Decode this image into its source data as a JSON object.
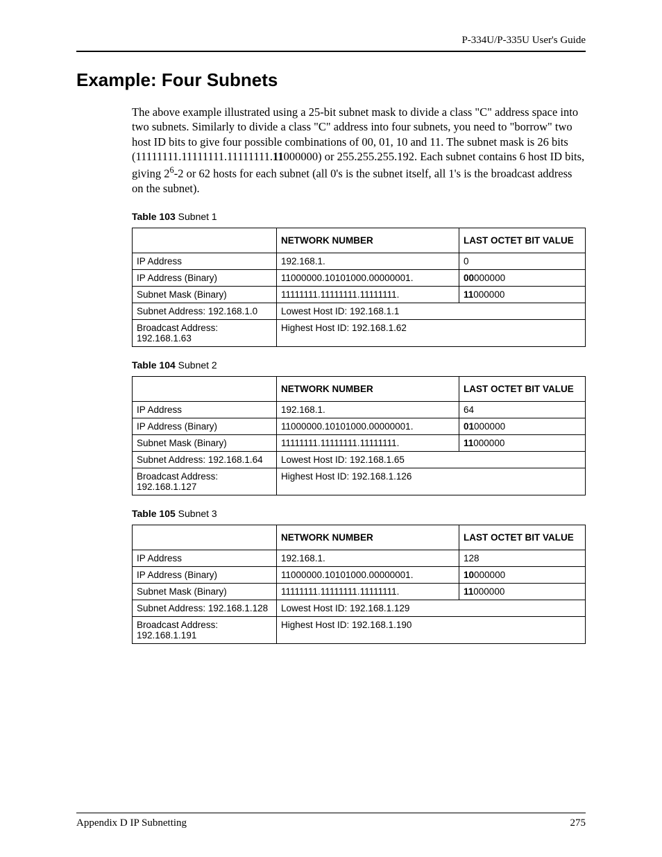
{
  "header": {
    "guide_title": "P-334U/P-335U User's Guide"
  },
  "section": {
    "title": "Example: Four Subnets"
  },
  "body": {
    "p1_a": "The above example illustrated using a 25-bit subnet mask to divide a class \"C\" address space into two subnets. Similarly to divide a class \"C\" address into four subnets, you need to \"borrow\" two host ID bits to give four possible combinations of 00, 01, 10 and 11. The subnet mask is 26 bits (11111111.11111111.11111111.",
    "p1_bold": "11",
    "p1_b": "000000) or 255.255.255.192. Each subnet contains 6 host ID bits, giving 2",
    "p1_sup": "6",
    "p1_c": "-2 or 62 hosts for each subnet (all 0's is the subnet itself, all 1's is the broadcast address on the subnet)."
  },
  "tables": [
    {
      "caption_bold": "Table 103",
      "caption_rest": "   Subnet 1",
      "headers": [
        "",
        "NETWORK NUMBER",
        "LAST OCTET BIT VALUE"
      ],
      "rows": [
        {
          "cells": [
            "IP Address",
            "192.168.1.",
            "0"
          ]
        },
        {
          "cells": [
            "IP Address (Binary)",
            "11000000.10101000.00000001.",
            {
              "bold": "00",
              "rest": "000000"
            }
          ]
        },
        {
          "cells": [
            "Subnet Mask (Binary)",
            "11111111.11111111.11111111.",
            {
              "bold": "11",
              "rest": "000000"
            }
          ]
        },
        {
          "cells": [
            "Subnet Address: 192.168.1.0",
            "Lowest Host ID: 192.168.1.1"
          ],
          "span": true
        },
        {
          "cells": [
            "Broadcast Address: 192.168.1.63",
            "Highest Host ID: 192.168.1.62"
          ],
          "span": true
        }
      ]
    },
    {
      "caption_bold": "Table 104",
      "caption_rest": "   Subnet 2",
      "headers": [
        "",
        "NETWORK NUMBER",
        "LAST OCTET BIT VALUE"
      ],
      "rows": [
        {
          "cells": [
            "IP Address",
            "192.168.1.",
            "64"
          ]
        },
        {
          "cells": [
            "IP Address (Binary)",
            "11000000.10101000.00000001.",
            {
              "bold": "01",
              "rest": "000000"
            }
          ]
        },
        {
          "cells": [
            "Subnet Mask (Binary)",
            "11111111.11111111.11111111.",
            {
              "bold": "11",
              "rest": "000000"
            }
          ]
        },
        {
          "cells": [
            "Subnet Address: 192.168.1.64",
            "Lowest Host ID: 192.168.1.65"
          ],
          "span": true
        },
        {
          "cells": [
            "Broadcast Address: 192.168.1.127",
            "Highest Host ID: 192.168.1.126"
          ],
          "span": true
        }
      ]
    },
    {
      "caption_bold": "Table 105",
      "caption_rest": "   Subnet 3",
      "headers": [
        "",
        "NETWORK NUMBER",
        "LAST OCTET BIT VALUE"
      ],
      "rows": [
        {
          "cells": [
            "IP Address",
            "192.168.1.",
            "128"
          ]
        },
        {
          "cells": [
            "IP Address (Binary)",
            "11000000.10101000.00000001.",
            {
              "bold": "10",
              "rest": "000000"
            }
          ]
        },
        {
          "cells": [
            "Subnet Mask (Binary)",
            "11111111.11111111.11111111.",
            {
              "bold": "11",
              "rest": "000000"
            }
          ]
        },
        {
          "cells": [
            "Subnet Address: 192.168.1.128",
            "Lowest Host ID: 192.168.1.129"
          ],
          "span": true
        },
        {
          "cells": [
            "Broadcast Address: 192.168.1.191",
            "Highest Host ID: 192.168.1.190"
          ],
          "span": true
        }
      ]
    }
  ],
  "footer": {
    "appendix": "Appendix D IP Subnetting",
    "page": "275"
  }
}
